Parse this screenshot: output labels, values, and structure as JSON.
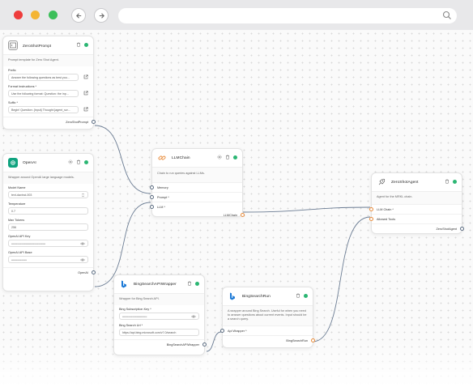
{
  "browser": {
    "title_bar_dots": [
      "close",
      "minimize",
      "maximize"
    ],
    "back_icon": "arrow-left-icon",
    "forward_icon": "arrow-right-icon",
    "search_icon": "search-icon"
  },
  "nodes": {
    "zeroshot_prompt": {
      "title": "ZeroShotPrompt",
      "icon": "prompt-icon",
      "description": "Prompt template for Zero Shot Agent.",
      "fields": [
        {
          "label": "Prefix",
          "value": "Answer the following questions as best you..."
        },
        {
          "label": "Format Instructions *",
          "value": "Use the following format: Question: the inp..."
        },
        {
          "label": "Suffix *",
          "value": "Begin! Question: {input} Thought:{agent_scr..."
        }
      ],
      "output": "ZeroShotPrompt"
    },
    "openai": {
      "title": "OpenAI",
      "icon": "openai-icon",
      "description": "Wrapper around OpenAI large language models.",
      "fields": [
        {
          "label": "Model Name",
          "value": "text-davinci-003"
        },
        {
          "label": "Temperature",
          "value": "0.7"
        },
        {
          "label": "Max Tokens",
          "value": "256"
        },
        {
          "label": "OpenAI API Key",
          "value": "••••••••••••••••••••••••••••••••••••••••"
        },
        {
          "label": "OpenAI API Base",
          "value": "••••••••••••••••••"
        }
      ],
      "output": "OpenAI"
    },
    "llmchain": {
      "title": "LLMChain",
      "icon": "chain-icon",
      "description": "Chain to run queries against LLMs.",
      "inputs": [
        "Memory",
        "Prompt *",
        "LLM *"
      ],
      "output": "LLMChain"
    },
    "zeroshot_agent": {
      "title": "ZeroShotAgent",
      "icon": "agent-icon",
      "description": "Agent for the MRKL chain.",
      "inputs": [
        "LLM Chain *",
        "Allowed Tools"
      ],
      "output": "ZeroShotAgent"
    },
    "bing_wrapper": {
      "title": "BingSearchAPIWrapper",
      "icon": "bing-icon",
      "description": "Wrapper for Bing Search API.",
      "fields": [
        {
          "label": "Bing Subscription Key *",
          "value": "•••••••••••••••••••••••••••••"
        },
        {
          "label": "Bing Search Url *",
          "value": "https://api.bing.microsoft.com/v7.0/search"
        }
      ],
      "output": "BingSearchAPIWrapper"
    },
    "bing_run": {
      "title": "BingSearchRun",
      "icon": "bing-icon",
      "description": "A wrapper around Bing Search. Useful for when you need to answer questions about current events. Input should be a search query.",
      "inputs": [
        "Api Wrapper *"
      ],
      "output": "BingSearchRun"
    }
  },
  "colors": {
    "status_green": "#2bb673",
    "edge": "#6b7c93",
    "handle_orange": "#e88b3a"
  }
}
